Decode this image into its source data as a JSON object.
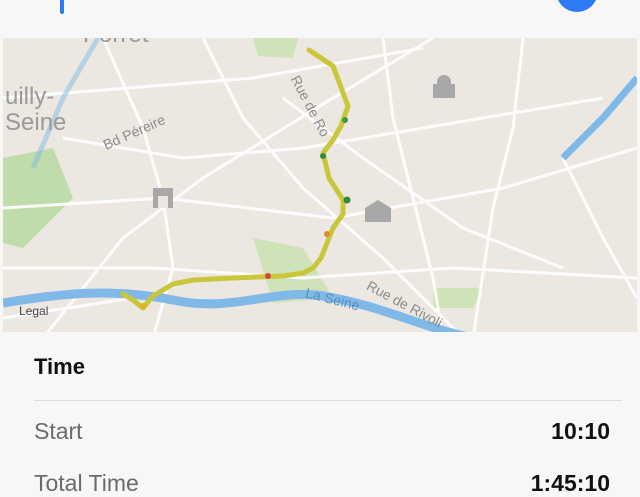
{
  "map": {
    "place_top": "Porret",
    "place_left_1": "uilly-",
    "place_left_2": "Seine",
    "street_1": "Bd Péreire",
    "street_2": "Rue de Ro",
    "street_3": "La Seine",
    "street_4": "Rue de Rivoli",
    "legal": "Legal",
    "route_color": "#c9c63a",
    "water_color": "#80b9e8",
    "park_color": "#bfdcaa"
  },
  "details": {
    "section_title": "Time",
    "rows": [
      {
        "label": "Start",
        "value": "10:10"
      },
      {
        "label": "Total Time",
        "value": "1:45:10"
      }
    ]
  },
  "colors": {
    "accent": "#2f7bf5"
  }
}
